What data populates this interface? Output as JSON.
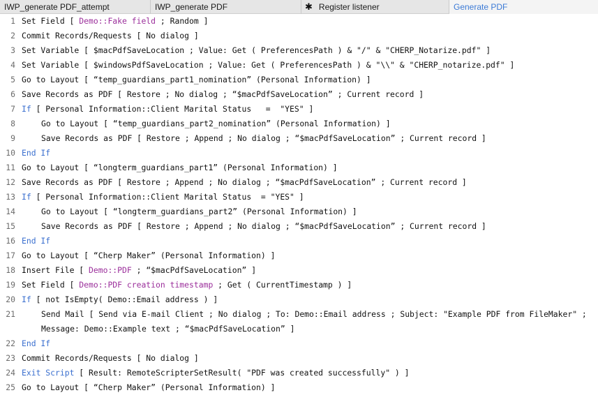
{
  "tabs": [
    {
      "label": "IWP_generate PDF_attempt",
      "active": false,
      "modified": false
    },
    {
      "label": "IWP_generate PDF",
      "active": false,
      "modified": false
    },
    {
      "label": "Register listener",
      "active": false,
      "modified": true
    },
    {
      "label": "Generate PDF",
      "active": true,
      "modified": false
    }
  ],
  "colors": {
    "keyword": "#3a6fcf",
    "field": "#9b2f9b",
    "active_tab": "#3d7bd6"
  },
  "lines": [
    {
      "n": "1",
      "indent": false,
      "tokens": [
        {
          "t": "Set Field [ ",
          "c": "lit"
        },
        {
          "t": "Demo::Fake field",
          "c": "fld"
        },
        {
          "t": " ; Random ]",
          "c": "lit"
        }
      ]
    },
    {
      "n": "2",
      "indent": false,
      "tokens": [
        {
          "t": "Commit Records/Requests [ No dialog ]",
          "c": "lit"
        }
      ]
    },
    {
      "n": "3",
      "indent": false,
      "tokens": [
        {
          "t": "Set Variable [ $macPdfSaveLocation ; Value: Get ( PreferencesPath ) & \"/\" & \"CHERP_Notarize.pdf\" ]",
          "c": "lit"
        }
      ]
    },
    {
      "n": "4",
      "indent": false,
      "tokens": [
        {
          "t": "Set Variable [ $windowsPdfSaveLocation ; Value: Get ( PreferencesPath ) & \"\\\\\" & \"CHERP_notarize.pdf\" ]",
          "c": "lit"
        }
      ]
    },
    {
      "n": "5",
      "indent": false,
      "tokens": [
        {
          "t": "Go to Layout [ “temp_guardians_part1_nomination” (Personal Information) ]",
          "c": "lit"
        }
      ]
    },
    {
      "n": "6",
      "indent": false,
      "tokens": [
        {
          "t": "Save Records as PDF [ Restore ; No dialog ; “$macPdfSaveLocation” ; Current record ]",
          "c": "lit"
        }
      ]
    },
    {
      "n": "7",
      "indent": false,
      "tokens": [
        {
          "t": "If",
          "c": "kw"
        },
        {
          "t": " [ Personal Information::Client Marital Status   =  \"YES\" ]",
          "c": "lit"
        }
      ]
    },
    {
      "n": "8",
      "indent": true,
      "tokens": [
        {
          "t": "Go to Layout [ “temp_guardians_part2_nomination” (Personal Information) ]",
          "c": "lit"
        }
      ]
    },
    {
      "n": "9",
      "indent": true,
      "tokens": [
        {
          "t": "Save Records as PDF [ Restore ; Append ; No dialog ; “$macPdfSaveLocation” ; Current record ]",
          "c": "lit"
        }
      ]
    },
    {
      "n": "10",
      "indent": false,
      "tokens": [
        {
          "t": "End If",
          "c": "kw"
        }
      ]
    },
    {
      "n": "11",
      "indent": false,
      "tokens": [
        {
          "t": "Go to Layout [ “longterm_guardians_part1” (Personal Information) ]",
          "c": "lit"
        }
      ]
    },
    {
      "n": "12",
      "indent": false,
      "tokens": [
        {
          "t": "Save Records as PDF [ Restore ; Append ; No dialog ; “$macPdfSaveLocation” ; Current record ]",
          "c": "lit"
        }
      ]
    },
    {
      "n": "13",
      "indent": false,
      "tokens": [
        {
          "t": "If",
          "c": "kw"
        },
        {
          "t": " [ Personal Information::Client Marital Status  = \"YES\" ]",
          "c": "lit"
        }
      ]
    },
    {
      "n": "14",
      "indent": true,
      "tokens": [
        {
          "t": "Go to Layout [ “longterm_guardians_part2” (Personal Information) ]",
          "c": "lit"
        }
      ]
    },
    {
      "n": "15",
      "indent": true,
      "tokens": [
        {
          "t": "Save Records as PDF [ Restore ; Append ; No dialog ; “$macPdfSaveLocation” ; Current record ]",
          "c": "lit"
        }
      ]
    },
    {
      "n": "16",
      "indent": false,
      "tokens": [
        {
          "t": "End If",
          "c": "kw"
        }
      ]
    },
    {
      "n": "17",
      "indent": false,
      "tokens": [
        {
          "t": "Go to Layout [ “Cherp Maker” (Personal Information) ]",
          "c": "lit"
        }
      ]
    },
    {
      "n": "18",
      "indent": false,
      "tokens": [
        {
          "t": "Insert File [ ",
          "c": "lit"
        },
        {
          "t": "Demo::PDF",
          "c": "fld"
        },
        {
          "t": " ; “$macPdfSaveLocation” ]",
          "c": "lit"
        }
      ]
    },
    {
      "n": "19",
      "indent": false,
      "tokens": [
        {
          "t": "Set Field [ ",
          "c": "lit"
        },
        {
          "t": "Demo::PDF creation timestamp",
          "c": "fld"
        },
        {
          "t": " ; Get ( CurrentTimestamp ) ]",
          "c": "lit"
        }
      ]
    },
    {
      "n": "20",
      "indent": false,
      "tokens": [
        {
          "t": "If",
          "c": "kw"
        },
        {
          "t": " [ not IsEmpty( Demo::Email address ) ]",
          "c": "lit"
        }
      ]
    },
    {
      "n": "21",
      "indent": true,
      "tokens": [
        {
          "t": "Send Mail [ Send via E-mail Client ; No dialog ; To: Demo::Email address ; Subject: \"Example PDF from FileMaker\" ;",
          "c": "lit"
        }
      ]
    },
    {
      "n": "",
      "indent": true,
      "tokens": [
        {
          "t": "Message: Demo::Example text ; “$macPdfSaveLocation” ]",
          "c": "lit"
        }
      ]
    },
    {
      "n": "22",
      "indent": false,
      "tokens": [
        {
          "t": "End If",
          "c": "kw"
        }
      ]
    },
    {
      "n": "23",
      "indent": false,
      "tokens": [
        {
          "t": "Commit Records/Requests [ No dialog ]",
          "c": "lit"
        }
      ]
    },
    {
      "n": "24",
      "indent": false,
      "tokens": [
        {
          "t": "Exit Script",
          "c": "kw"
        },
        {
          "t": " [ Result: RemoteScripterSetResult( \"PDF was created successfully\" ) ]",
          "c": "lit"
        }
      ]
    },
    {
      "n": "25",
      "indent": false,
      "tokens": [
        {
          "t": "Go to Layout [ “Cherp Maker” (Personal Information) ]",
          "c": "lit"
        }
      ]
    }
  ]
}
